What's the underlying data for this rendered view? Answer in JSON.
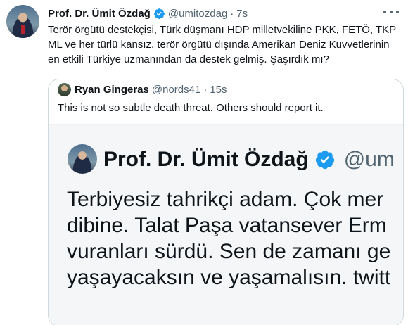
{
  "tweet": {
    "author_name": "Prof. Dr. Ümit Özdağ",
    "handle": "@umitozdag",
    "separator": "·",
    "time": "7s",
    "text": "Terör örgütü destekçisi, Türk düşmanı HDP milletvekiline PKK, FETÖ, TKP ML ve her türlü kansız, terör örgütü dışında Amerikan Deniz Kuvvetlerinin en etkili Türkiye uzmanından da destek gelmiş. Şaşırdık mı?"
  },
  "quote": {
    "author_name": "Ryan Gingeras",
    "handle": "@nords41",
    "separator": "·",
    "time": "15s",
    "text": "This is not so subtle death threat. Others should report it.",
    "media": {
      "author_name": "Prof. Dr. Ümit Özdağ",
      "handle": "@um",
      "lines": [
        "Terbiyesiz tahrikçi adam. Çok mer",
        "dibine. Talat Paşa vatansever Erm",
        "vuranları sürdü. Sen de zamanı ge",
        "yaşayacaksın ve yaşamalısın. twitt"
      ]
    }
  },
  "icons": {
    "verified": "verified-badge-icon",
    "more": "more-options-icon"
  },
  "colors": {
    "verified_blue": "#1d9bf0",
    "secondary_text": "#536471",
    "border": "#cfd9de"
  }
}
